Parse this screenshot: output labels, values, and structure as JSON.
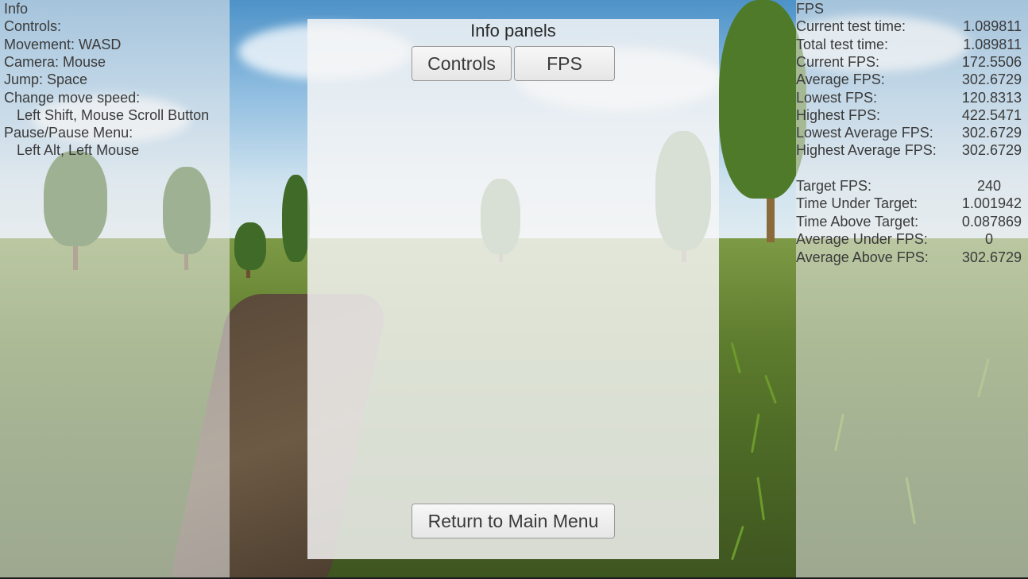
{
  "info_panel": {
    "title": "Info",
    "controls_heading": "Controls:",
    "movement": "Movement: WASD",
    "camera": "Camera: Mouse",
    "jump": "Jump: Space",
    "change_speed_heading": "Change move speed:",
    "change_speed_keys": "Left Shift, Mouse Scroll Button",
    "pause_heading": "Pause/Pause Menu:",
    "pause_keys": "Left Alt, Left Mouse"
  },
  "center_panel": {
    "title": "Info panels",
    "controls_button": "Controls",
    "fps_button": "FPS",
    "return_button": "Return to Main Menu"
  },
  "fps_panel": {
    "title": "FPS",
    "rows": [
      {
        "label": "Current test time:",
        "value": "1.089811"
      },
      {
        "label": "Total test time:",
        "value": "1.089811"
      },
      {
        "label": "Current FPS:",
        "value": "172.5506"
      },
      {
        "label": "Average FPS:",
        "value": "302.6729"
      },
      {
        "label": "Lowest FPS:",
        "value": "120.8313"
      },
      {
        "label": "Highest FPS:",
        "value": "422.5471"
      },
      {
        "label": "Lowest Average FPS:",
        "value": "302.6729"
      },
      {
        "label": "Highest Average FPS:",
        "value": "302.6729"
      }
    ],
    "target_rows": [
      {
        "label": "Target FPS:",
        "value": "240"
      },
      {
        "label": "Time Under Target:",
        "value": "1.001942"
      },
      {
        "label": "Time Above Target:",
        "value": "0.087869"
      },
      {
        "label": "Average Under FPS:",
        "value": "0"
      },
      {
        "label": "Average Above FPS:",
        "value": "302.6729"
      }
    ]
  }
}
